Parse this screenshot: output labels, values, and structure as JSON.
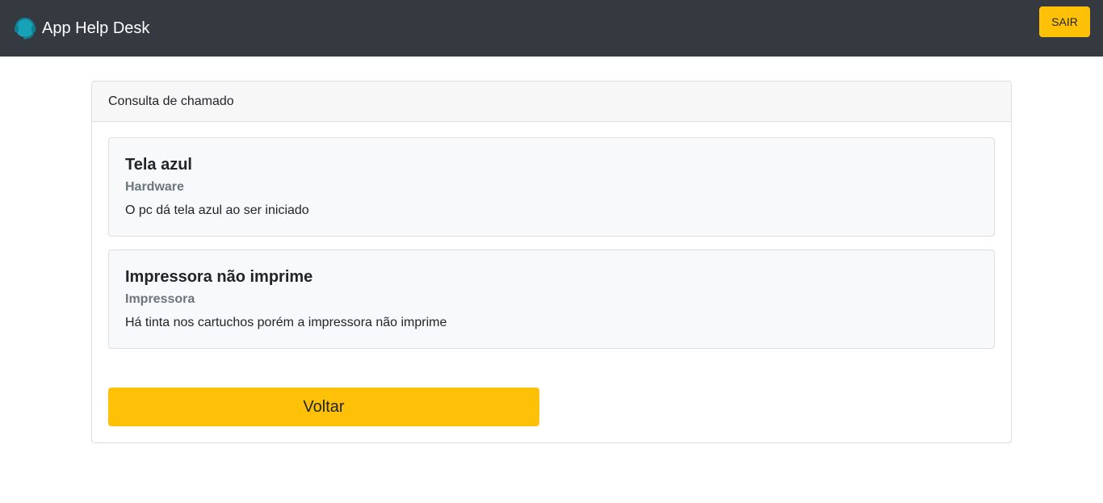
{
  "navbar": {
    "brand_title": "App Help Desk",
    "brand_icon": "headset-icon",
    "logout_label": "SAIR"
  },
  "card": {
    "header": "Consulta de chamado",
    "tickets": [
      {
        "title": "Tela azul",
        "category": "Hardware",
        "description": "O pc dá tela azul ao ser iniciado"
      },
      {
        "title": "Impressora não imprime",
        "category": "Impressora",
        "description": "Há tinta nos cartuchos porém a impressora não imprime"
      }
    ],
    "back_label": "Voltar"
  },
  "colors": {
    "navbar_bg": "#343a40",
    "accent_warning": "#ffc107",
    "brand_icon": "#17a2b8",
    "muted_text": "#6c757d"
  }
}
